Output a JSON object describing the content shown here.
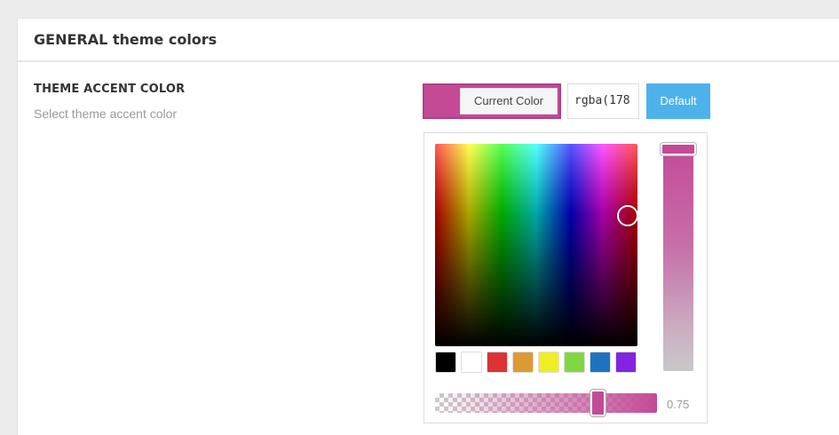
{
  "panel": {
    "title": "GENERAL theme colors"
  },
  "option": {
    "title": "THEME ACCENT COLOR",
    "description": "Select theme accent color"
  },
  "controls": {
    "current_color_label": "Current Color",
    "current_color_value": "#c44a96",
    "rgba_value": "rgba(178",
    "default_label": "Default"
  },
  "picker": {
    "swatches": [
      {
        "name": "black",
        "color": "#000000"
      },
      {
        "name": "white",
        "color": "#ffffff"
      },
      {
        "name": "red",
        "color": "#dd3333"
      },
      {
        "name": "orange",
        "color": "#dd9933"
      },
      {
        "name": "yellow",
        "color": "#eeee22"
      },
      {
        "name": "green",
        "color": "#81d742"
      },
      {
        "name": "blue",
        "color": "#1e73be"
      },
      {
        "name": "purple",
        "color": "#8224e3"
      }
    ],
    "alpha_value": "0.75"
  }
}
